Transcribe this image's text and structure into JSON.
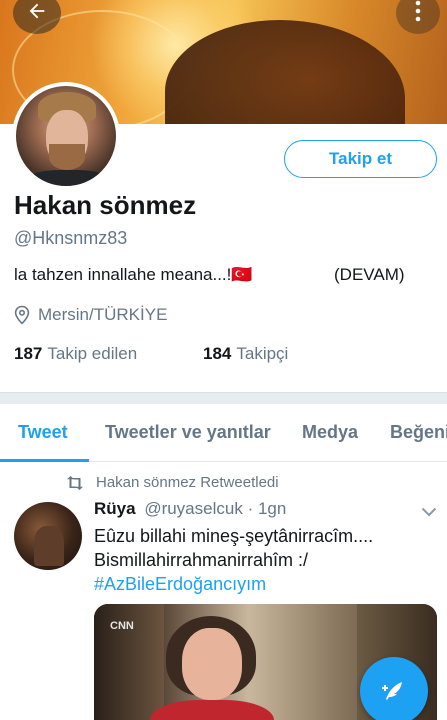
{
  "profile": {
    "name": "Hakan sönmez",
    "handle": "@Hknsnmz83",
    "bio_text": "la tahzen innallahe meana...!🇹🇷",
    "bio_more": "(DEVAM)",
    "location": "Mersin/TÜRKİYE",
    "following_count": "187",
    "following_label": "Takip edilen",
    "followers_count": "184",
    "followers_label": "Takipçi"
  },
  "actions": {
    "follow_label": "Takip et"
  },
  "tabs": [
    {
      "label": "Tweet"
    },
    {
      "label": "Tweetler ve yanıtlar"
    },
    {
      "label": "Medya"
    },
    {
      "label": "Beğeni"
    }
  ],
  "tweet": {
    "retweet_label": "Hakan sönmez Retweetledi",
    "author_name": "Rüya",
    "author_handle": "@ruyaselcuk",
    "separator": "·",
    "time": "1gn",
    "line1": "Eûzu billahi mineş-şeytânirracîm....",
    "line2": "Bismillahirrahmanirrahîm :/",
    "hashtag": "#AzBileErdoğancıyım",
    "media_brand": "CNN"
  },
  "icons": {
    "back": "arrow-left-icon",
    "more": "more-vertical-icon",
    "location": "location-pin-icon",
    "retweet": "retweet-icon",
    "chevron": "chevron-down-icon",
    "compose": "compose-feather-icon"
  },
  "colors": {
    "accent": "#1da1f2",
    "secondary_text": "#657786",
    "primary_text": "#14171a"
  }
}
